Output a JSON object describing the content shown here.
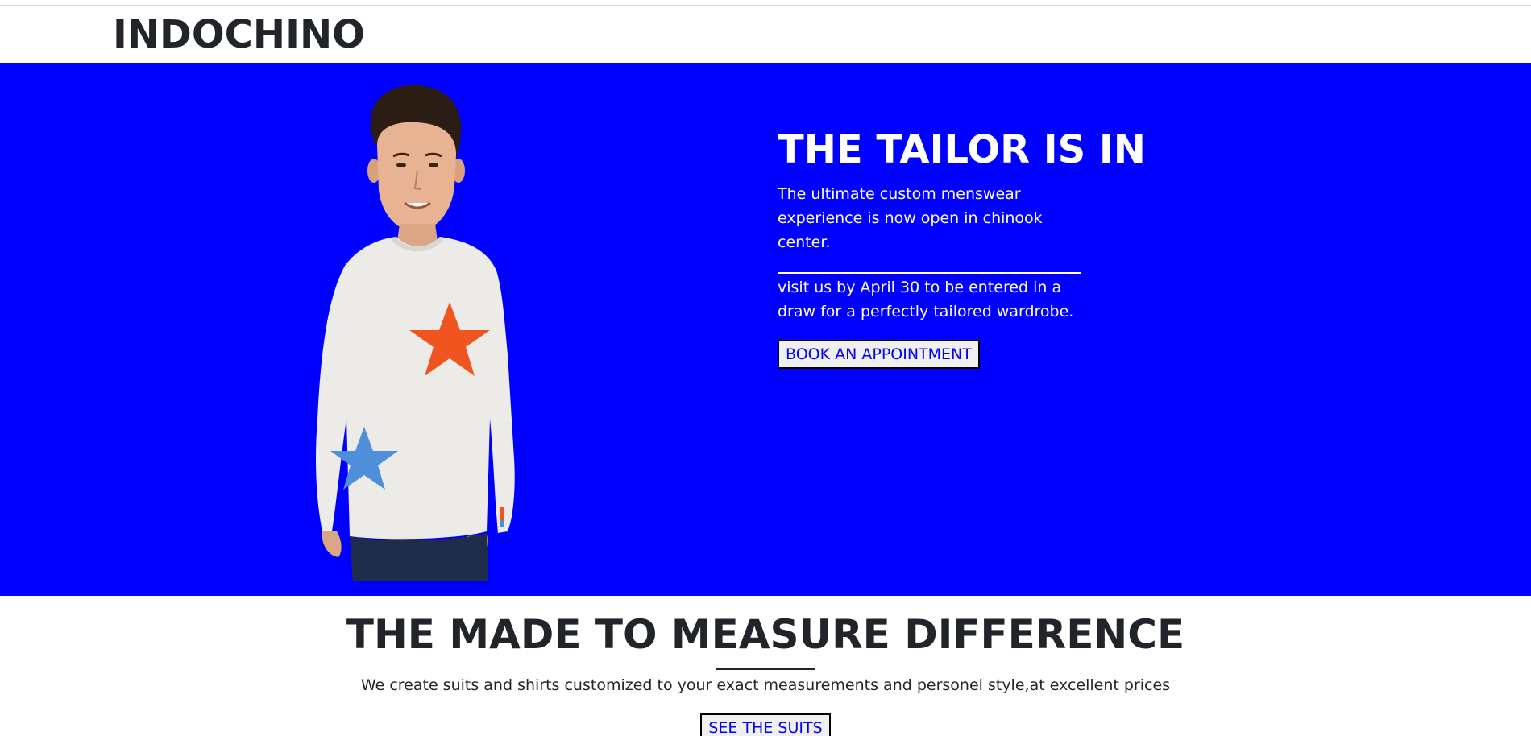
{
  "brand": {
    "name": "INDOCHINO"
  },
  "hero": {
    "title": "THE TAILOR IS IN",
    "copy": "The ultimate custom menswear experience is now open in chinook center.",
    "copy2": "visit us by April 30 to be entered in a draw for a perfectly tailored wardrobe.",
    "button_label": "BOOK AN APPOINTMENT",
    "background_color": "#0000ff"
  },
  "section": {
    "title": "THE MADE TO MEASURE DIFFERENCE",
    "copy": "We create suits and shirts customized to your exact measurements and personel style,at excellent prices",
    "button_label": "SEE THE SUITS"
  },
  "colors": {
    "link_text": "#0000ff",
    "button_bg": "#f0f0f0",
    "text_dark": "#212529"
  }
}
